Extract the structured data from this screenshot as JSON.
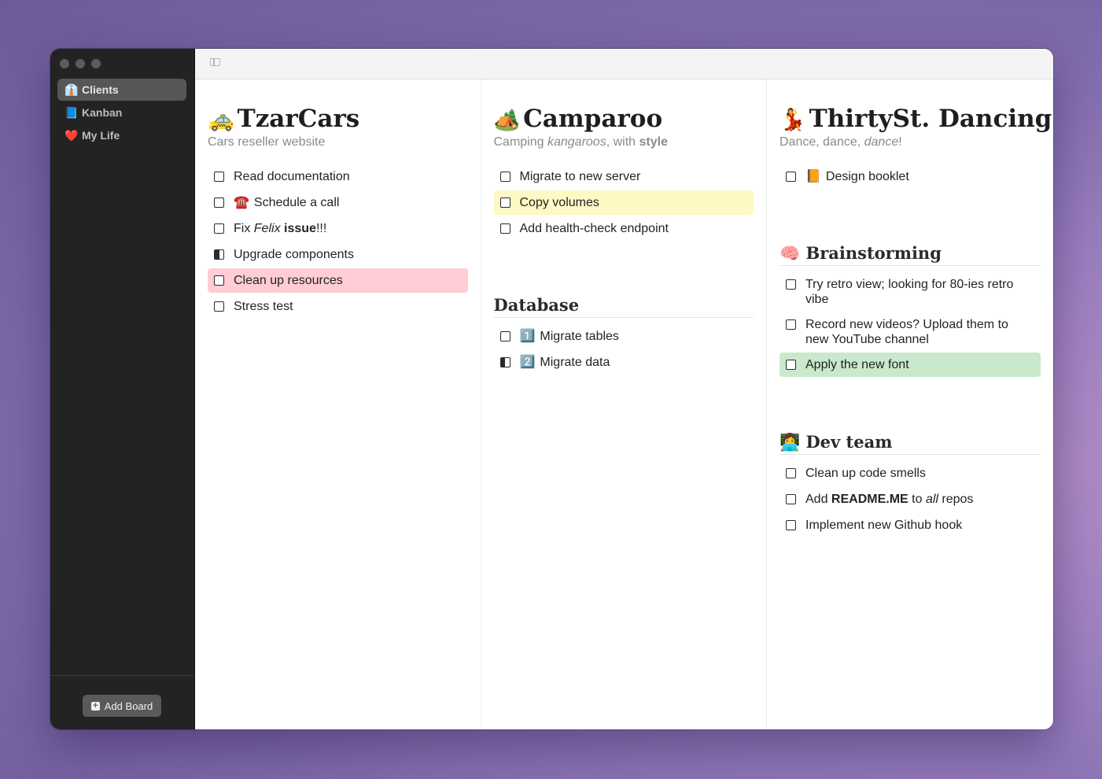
{
  "window": {
    "traffic_lights": [
      "close",
      "minimize",
      "zoom"
    ]
  },
  "sidebar": {
    "items": [
      {
        "icon": "👔",
        "label": "Clients",
        "active": true
      },
      {
        "icon": "📘",
        "label": "Kanban",
        "active": false
      },
      {
        "icon": "❤️",
        "label": "My Life",
        "active": false
      }
    ],
    "add_board_label": "Add Board"
  },
  "toolbar": {
    "toggle_icon": "sidebar-toggle-icon"
  },
  "boards": [
    {
      "emoji": "🚕",
      "title": "TzarCars",
      "subtitle": "Cars reseller website",
      "tasks": [
        {
          "state": "todo",
          "parts": [
            {
              "t": "Read documentation"
            }
          ]
        },
        {
          "state": "todo",
          "emoji": "☎️",
          "parts": [
            {
              "t": "Schedule a call"
            }
          ]
        },
        {
          "state": "todo",
          "parts": [
            {
              "t": "Fix "
            },
            {
              "t": "Felix",
              "s": "i"
            },
            {
              "t": " "
            },
            {
              "t": "issue",
              "s": "b"
            },
            {
              "t": "!!!"
            }
          ]
        },
        {
          "state": "in-progress",
          "parts": [
            {
              "t": "Upgrade components"
            }
          ]
        },
        {
          "state": "todo",
          "highlight": "red",
          "parts": [
            {
              "t": "Clean up resources"
            }
          ]
        },
        {
          "state": "todo",
          "parts": [
            {
              "t": "Stress test"
            }
          ]
        }
      ]
    },
    {
      "emoji": "🏕️",
      "title": "Camparoo",
      "subtitle_parts": [
        {
          "t": "Camping "
        },
        {
          "t": "kangaroos",
          "s": "i"
        },
        {
          "t": ", with "
        },
        {
          "t": "style",
          "s": "b"
        }
      ],
      "tasks": [
        {
          "state": "todo",
          "parts": [
            {
              "t": "Migrate to new server"
            }
          ]
        },
        {
          "state": "todo",
          "highlight": "yellow",
          "parts": [
            {
              "t": "Copy volumes"
            }
          ]
        },
        {
          "state": "todo",
          "parts": [
            {
              "t": "Add health-check endpoint"
            }
          ]
        }
      ],
      "sections": [
        {
          "title": "Database",
          "tasks": [
            {
              "state": "todo",
              "emoji": "1️⃣",
              "parts": [
                {
                  "t": "Migrate tables"
                }
              ]
            },
            {
              "state": "in-progress",
              "emoji": "2️⃣",
              "parts": [
                {
                  "t": "Migrate data"
                }
              ]
            }
          ]
        }
      ]
    },
    {
      "emoji": "💃",
      "title": "ThirtySt. Dancing",
      "subtitle_parts": [
        {
          "t": "Dance, dance, "
        },
        {
          "t": "dance",
          "s": "i"
        },
        {
          "t": "!"
        }
      ],
      "tasks": [
        {
          "state": "todo",
          "emoji": "📙",
          "parts": [
            {
              "t": "Design booklet"
            }
          ]
        }
      ],
      "sections": [
        {
          "emoji": "🧠",
          "title": "Brainstorming",
          "tasks": [
            {
              "state": "todo",
              "parts": [
                {
                  "t": "Try retro view; looking for 80-ies retro vibe"
                }
              ]
            },
            {
              "state": "todo",
              "parts": [
                {
                  "t": "Record new videos? Upload them to new YouTube channel"
                }
              ]
            },
            {
              "state": "todo",
              "highlight": "green",
              "parts": [
                {
                  "t": "Apply the new font"
                }
              ]
            }
          ]
        },
        {
          "emoji": "👩‍💻",
          "title": "Dev team",
          "tasks": [
            {
              "state": "todo",
              "parts": [
                {
                  "t": "Clean up code smells"
                }
              ]
            },
            {
              "state": "todo",
              "parts": [
                {
                  "t": "Add "
                },
                {
                  "t": "README.ME",
                  "s": "b"
                },
                {
                  "t": " to "
                },
                {
                  "t": "all",
                  "s": "i"
                },
                {
                  "t": " repos"
                }
              ]
            },
            {
              "state": "todo",
              "parts": [
                {
                  "t": "Implement new Github hook"
                }
              ]
            }
          ]
        }
      ]
    }
  ]
}
